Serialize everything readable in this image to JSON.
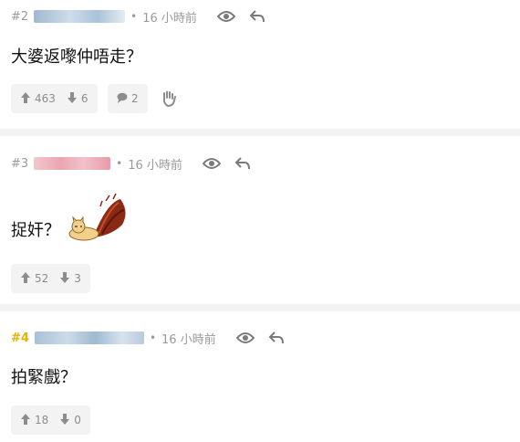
{
  "posts": [
    {
      "number": "#2",
      "time": "16 小時前",
      "dot": "•",
      "content": "大婆返嚟仲唔走？",
      "upvotes": "463",
      "downvotes": "6",
      "comments": "2"
    },
    {
      "number": "#3",
      "time": "16 小時前",
      "dot": "•",
      "content": "捉奸？",
      "upvotes": "52",
      "downvotes": "3"
    },
    {
      "number": "#4",
      "time": "16 小時前",
      "dot": "•",
      "content": "拍緊戲？",
      "upvotes": "18",
      "downvotes": "0"
    }
  ],
  "colors": {
    "number_highlight": "#e5b300",
    "user_blur_blue": "#b9cde0",
    "user_blur_pink": "#eeb6c0",
    "divider": "#f2f2f2"
  },
  "icons": [
    "eye-icon",
    "reply-icon",
    "arrow-up-icon",
    "arrow-down-icon",
    "comment-icon",
    "wave-hand-icon",
    "sticker-icon"
  ]
}
